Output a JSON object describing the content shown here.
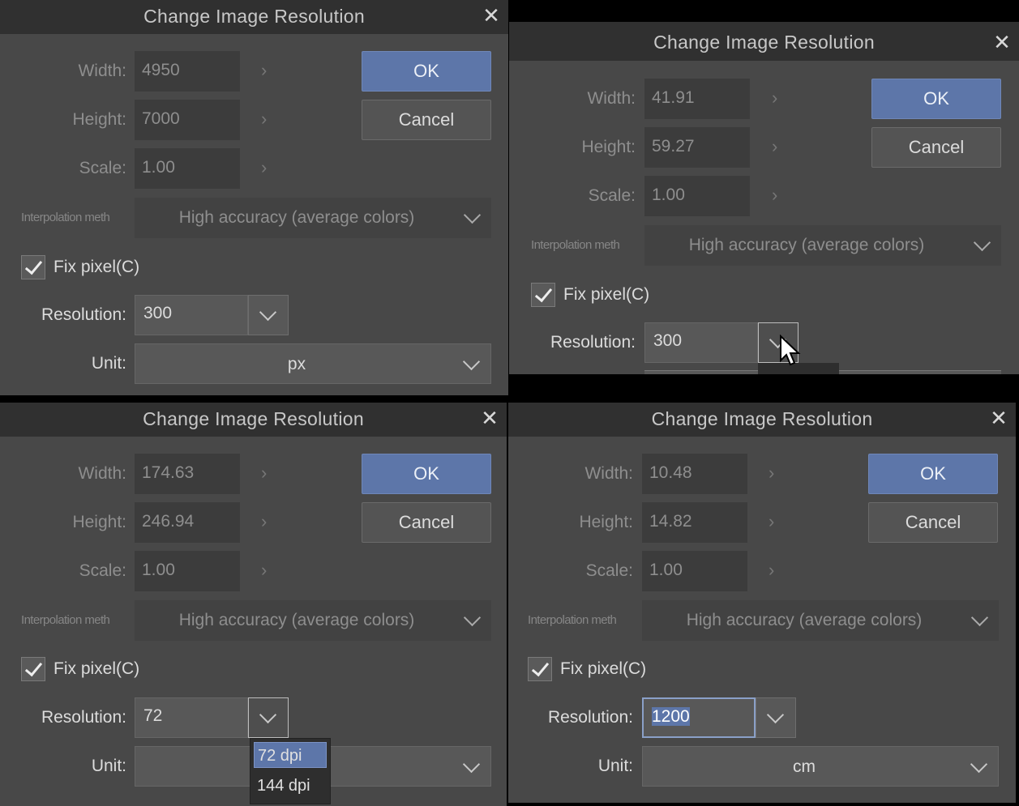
{
  "dialogs": [
    {
      "title": "Change Image Resolution",
      "width_label": "Width:",
      "width_value": "4950",
      "height_label": "Height:",
      "height_value": "7000",
      "scale_label": "Scale:",
      "scale_value": "1.00",
      "interp_label": "Interpolation meth",
      "interp_value": "High accuracy (average colors)",
      "fixpixel_label": "Fix pixel(C)",
      "fixpixel_checked": true,
      "resolution_label": "Resolution:",
      "resolution_value": "300",
      "unit_label": "Unit:",
      "unit_value": "px",
      "ok_label": "OK",
      "cancel_label": "Cancel"
    },
    {
      "title": "Change Image Resolution",
      "width_label": "Width:",
      "width_value": "41.91",
      "height_label": "Height:",
      "height_value": "59.27",
      "scale_label": "Scale:",
      "scale_value": "1.00",
      "interp_label": "Interpolation meth",
      "interp_value": "High accuracy (average colors)",
      "fixpixel_label": "Fix pixel(C)",
      "fixpixel_checked": true,
      "resolution_label": "Resolution:",
      "resolution_value": "300",
      "ok_label": "OK",
      "cancel_label": "Cancel"
    },
    {
      "title": "Change Image Resolution",
      "width_label": "Width:",
      "width_value": "174.63",
      "height_label": "Height:",
      "height_value": "246.94",
      "scale_label": "Scale:",
      "scale_value": "1.00",
      "interp_label": "Interpolation meth",
      "interp_value": "High accuracy (average colors)",
      "fixpixel_label": "Fix pixel(C)",
      "fixpixel_checked": true,
      "resolution_label": "Resolution:",
      "resolution_value": "72",
      "unit_label": "Unit:",
      "unit_value": "",
      "resolution_options": [
        "72 dpi",
        "144 dpi"
      ],
      "ok_label": "OK",
      "cancel_label": "Cancel"
    },
    {
      "title": "Change Image Resolution",
      "width_label": "Width:",
      "width_value": "10.48",
      "height_label": "Height:",
      "height_value": "14.82",
      "scale_label": "Scale:",
      "scale_value": "1.00",
      "interp_label": "Interpolation meth",
      "interp_value": "High accuracy (average colors)",
      "fixpixel_label": "Fix pixel(C)",
      "fixpixel_checked": true,
      "resolution_label": "Resolution:",
      "resolution_value": "1200",
      "unit_label": "Unit:",
      "unit_value": "cm",
      "ok_label": "OK",
      "cancel_label": "Cancel"
    }
  ],
  "icons": {
    "close": "close-icon",
    "dropdown": "chevron-down-icon",
    "stepper": "chevron-right-icon",
    "check": "checkmark-icon",
    "cursor": "mouse-pointer-icon"
  },
  "colors": {
    "accent": "#5d76a9",
    "dialog_bg": "#484848",
    "titlebar_bg": "#303030"
  }
}
